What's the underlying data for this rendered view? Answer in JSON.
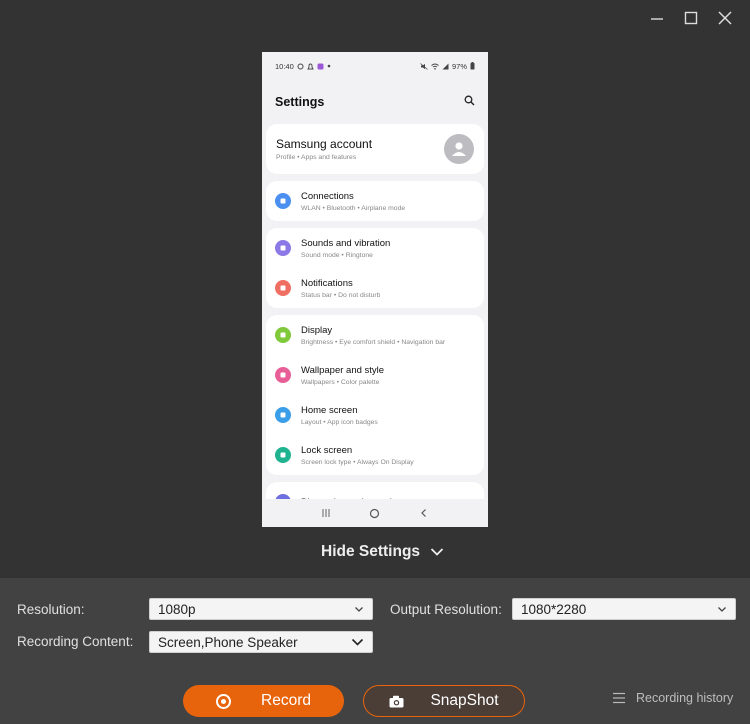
{
  "phone": {
    "status_time": "10:40",
    "battery": "97%",
    "header_title": "Settings",
    "account": {
      "name": "Samsung account",
      "sub": "Profile  •  Apps and features"
    },
    "groups": [
      [
        {
          "title": "Connections",
          "sub": "WLAN  •  Bluetooth  •  Airplane mode",
          "color": "#4b8ff0"
        }
      ],
      [
        {
          "title": "Sounds and vibration",
          "sub": "Sound mode  •  Ringtone",
          "color": "#8c79e6"
        },
        {
          "title": "Notifications",
          "sub": "Status bar  •  Do not disturb",
          "color": "#ef6f63"
        }
      ],
      [
        {
          "title": "Display",
          "sub": "Brightness  •  Eye comfort shield  •  Navigation bar",
          "color": "#7fc93a"
        },
        {
          "title": "Wallpaper and style",
          "sub": "Wallpapers  •  Color palette",
          "color": "#e85f98"
        },
        {
          "title": "Home screen",
          "sub": "Layout  •  App icon badges",
          "color": "#3a9ee8"
        },
        {
          "title": "Lock screen",
          "sub": "Screen lock type  •  Always On Display",
          "color": "#20b38f"
        }
      ],
      [
        {
          "title": "Biometrics and security",
          "sub": "",
          "color": "#6e6fe0"
        }
      ]
    ]
  },
  "hide_settings_label": "Hide Settings",
  "panel": {
    "resolution_label": "Resolution:",
    "resolution_value": "1080p",
    "output_resolution_label": "Output Resolution:",
    "output_resolution_value": "1080*2280",
    "recording_content_label": "Recording Content:",
    "recording_content_value": "Screen,Phone Speaker"
  },
  "actions": {
    "record_label": "Record",
    "snapshot_label": "SnapShot",
    "history_label": "Recording history"
  },
  "colors": {
    "accent": "#e8640c",
    "background": "#333333",
    "panel": "#424242"
  }
}
